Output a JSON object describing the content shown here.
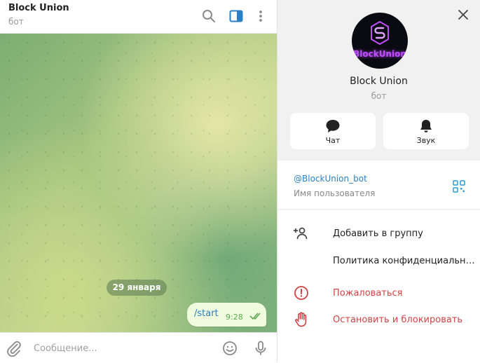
{
  "chat": {
    "title": "Block Union",
    "subtitle": "бот",
    "date_label": "29 января",
    "message": {
      "text": "/start",
      "time": "9:28"
    },
    "composer_placeholder": "Сообщение..."
  },
  "header_icons": [
    "search-icon",
    "sidebar-toggle-icon",
    "more-vertical-icon"
  ],
  "profile": {
    "logo_text": "BlockUnion",
    "name": "Block Union",
    "subtitle": "бот",
    "actions": [
      {
        "label": "Чат",
        "icon": "chat-bubble-icon"
      },
      {
        "label": "Звук",
        "icon": "bell-icon"
      }
    ],
    "username": "@BlockUnion_bot",
    "username_caption": "Имя пользователя"
  },
  "menu": [
    {
      "label": "Добавить в группу",
      "icon": "add-user-icon",
      "danger": false
    },
    {
      "label": "Политика конфиденциальности",
      "icon": "",
      "danger": false
    },
    {
      "label": "Пожаловаться",
      "icon": "report-icon",
      "danger": true
    },
    {
      "label": "Остановить и блокировать",
      "icon": "stop-hand-icon",
      "danger": true
    }
  ],
  "colors": {
    "accent": "#2b7fc4",
    "danger": "#d14343",
    "bubble": "#effdde",
    "logo": "#c04dff"
  }
}
